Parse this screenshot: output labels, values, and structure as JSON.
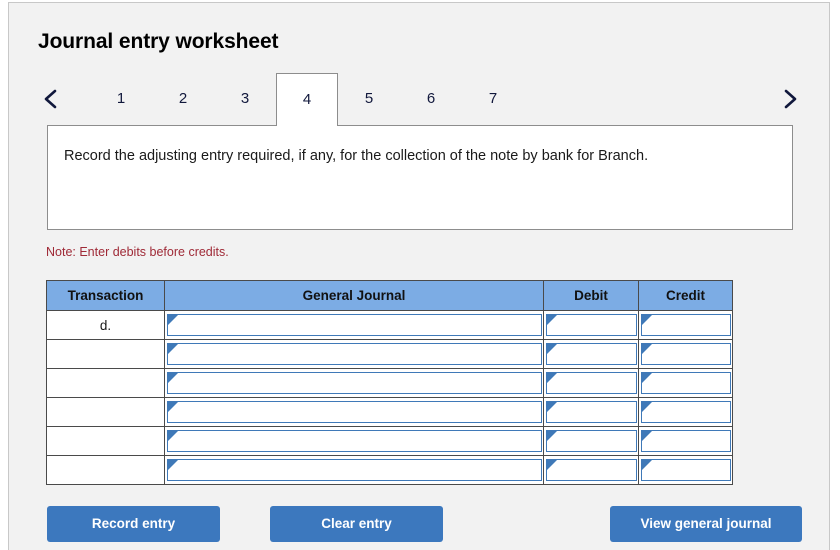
{
  "page": {
    "title": "Journal entry worksheet"
  },
  "tabs": {
    "prev_label": "previous",
    "next_label": "next",
    "items": [
      {
        "label": "1",
        "active": false
      },
      {
        "label": "2",
        "active": false
      },
      {
        "label": "3",
        "active": false
      },
      {
        "label": "4",
        "active": true
      },
      {
        "label": "5",
        "active": false
      },
      {
        "label": "6",
        "active": false
      },
      {
        "label": "7",
        "active": false
      }
    ]
  },
  "instruction": {
    "text": "Record the adjusting entry required, if any, for the collection of the note by bank for Branch."
  },
  "note": {
    "text": "Note: Enter debits before credits."
  },
  "table": {
    "headers": {
      "transaction": "Transaction",
      "general_journal": "General Journal",
      "debit": "Debit",
      "credit": "Credit"
    },
    "rows": [
      {
        "transaction": "d.",
        "general_journal": "",
        "debit": "",
        "credit": ""
      },
      {
        "transaction": "",
        "general_journal": "",
        "debit": "",
        "credit": ""
      },
      {
        "transaction": "",
        "general_journal": "",
        "debit": "",
        "credit": ""
      },
      {
        "transaction": "",
        "general_journal": "",
        "debit": "",
        "credit": ""
      },
      {
        "transaction": "",
        "general_journal": "",
        "debit": "",
        "credit": ""
      },
      {
        "transaction": "",
        "general_journal": "",
        "debit": "",
        "credit": ""
      }
    ]
  },
  "buttons": {
    "record": "Record entry",
    "clear": "Clear entry",
    "view": "View general journal"
  },
  "colors": {
    "button_blue": "#3c78be",
    "header_blue": "#7cace4",
    "input_border_blue": "#3f79b8",
    "note_red": "#9f2936",
    "page_bg": "#f2f2f2"
  }
}
